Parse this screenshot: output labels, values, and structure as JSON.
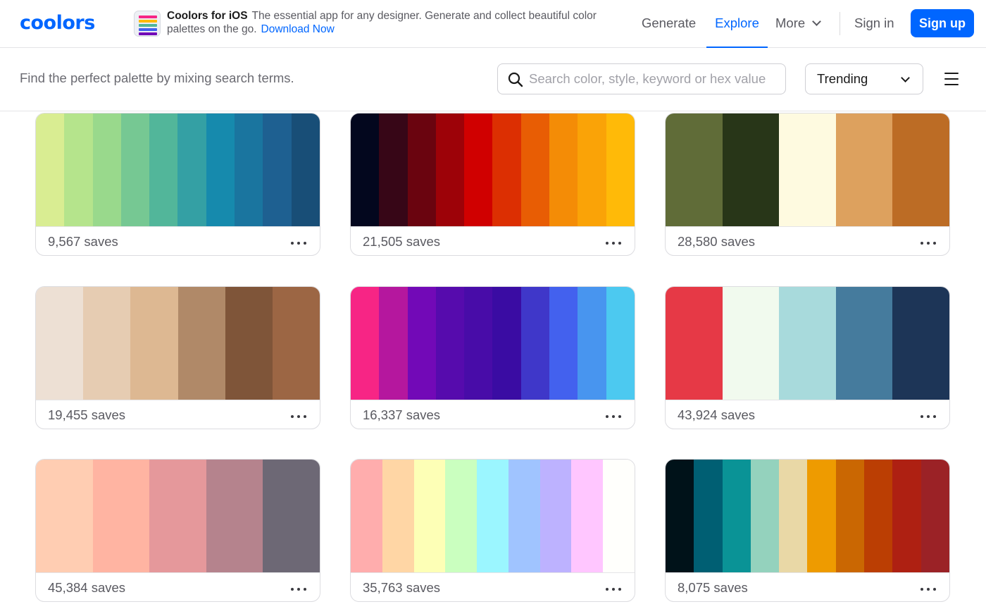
{
  "header": {
    "logo": "coolors",
    "promo": {
      "title": "Coolors for iOS",
      "text": "The essential app for any designer. Generate and collect beautiful color palettes on the go.",
      "link": "Download Now"
    },
    "nav": {
      "generate": "Generate",
      "explore": "Explore",
      "more": "More",
      "sign_in": "Sign in",
      "sign_up": "Sign up"
    },
    "accent": "#0066ff"
  },
  "search": {
    "tagline": "Find the perfect palette by mixing search terms.",
    "placeholder": "Search color, style, keyword or hex value",
    "value": "",
    "sort": "Trending"
  },
  "palettes": [
    {
      "saves": "9,567 saves",
      "colors": [
        "#d9ed92",
        "#b5e48c",
        "#99d98c",
        "#76c893",
        "#52b69a",
        "#34a0a4",
        "#168aad",
        "#1a759f",
        "#1e6091",
        "#184e77"
      ]
    },
    {
      "saves": "21,505 saves",
      "colors": [
        "#03071e",
        "#370617",
        "#6a040f",
        "#9d0208",
        "#d00000",
        "#dc2f02",
        "#e85d04",
        "#f48c06",
        "#faa307",
        "#ffba08"
      ]
    },
    {
      "saves": "28,580 saves",
      "colors": [
        "#606c38",
        "#283618",
        "#fefae0",
        "#dda15e",
        "#bc6c25"
      ]
    },
    {
      "saves": "19,455 saves",
      "colors": [
        "#ede0d4",
        "#e6ccb2",
        "#ddb892",
        "#b08968",
        "#7f5539",
        "#9c6644"
      ]
    },
    {
      "saves": "16,337 saves",
      "colors": [
        "#f72585",
        "#b5179e",
        "#7209b7",
        "#560bad",
        "#480ca8",
        "#3a0ca3",
        "#3f37c9",
        "#4361ee",
        "#4895ef",
        "#4cc9f0"
      ]
    },
    {
      "saves": "43,924 saves",
      "colors": [
        "#e63946",
        "#f1faee",
        "#a8dadc",
        "#457b9d",
        "#1d3557"
      ]
    },
    {
      "saves": "45,384 saves",
      "colors": [
        "#ffcdb2",
        "#ffb4a2",
        "#e5989b",
        "#b5838d",
        "#6d6875"
      ]
    },
    {
      "saves": "35,763 saves",
      "colors": [
        "#ffadad",
        "#ffd6a5",
        "#fdffb6",
        "#caffbf",
        "#9bf6ff",
        "#a0c4ff",
        "#bdb2ff",
        "#ffc6ff",
        "#fffffc"
      ]
    },
    {
      "saves": "8,075 saves",
      "colors": [
        "#001219",
        "#005f73",
        "#0a9396",
        "#94d2bd",
        "#e9d8a6",
        "#ee9b00",
        "#ca6702",
        "#bb3e03",
        "#ae2012",
        "#9b2226"
      ]
    }
  ]
}
